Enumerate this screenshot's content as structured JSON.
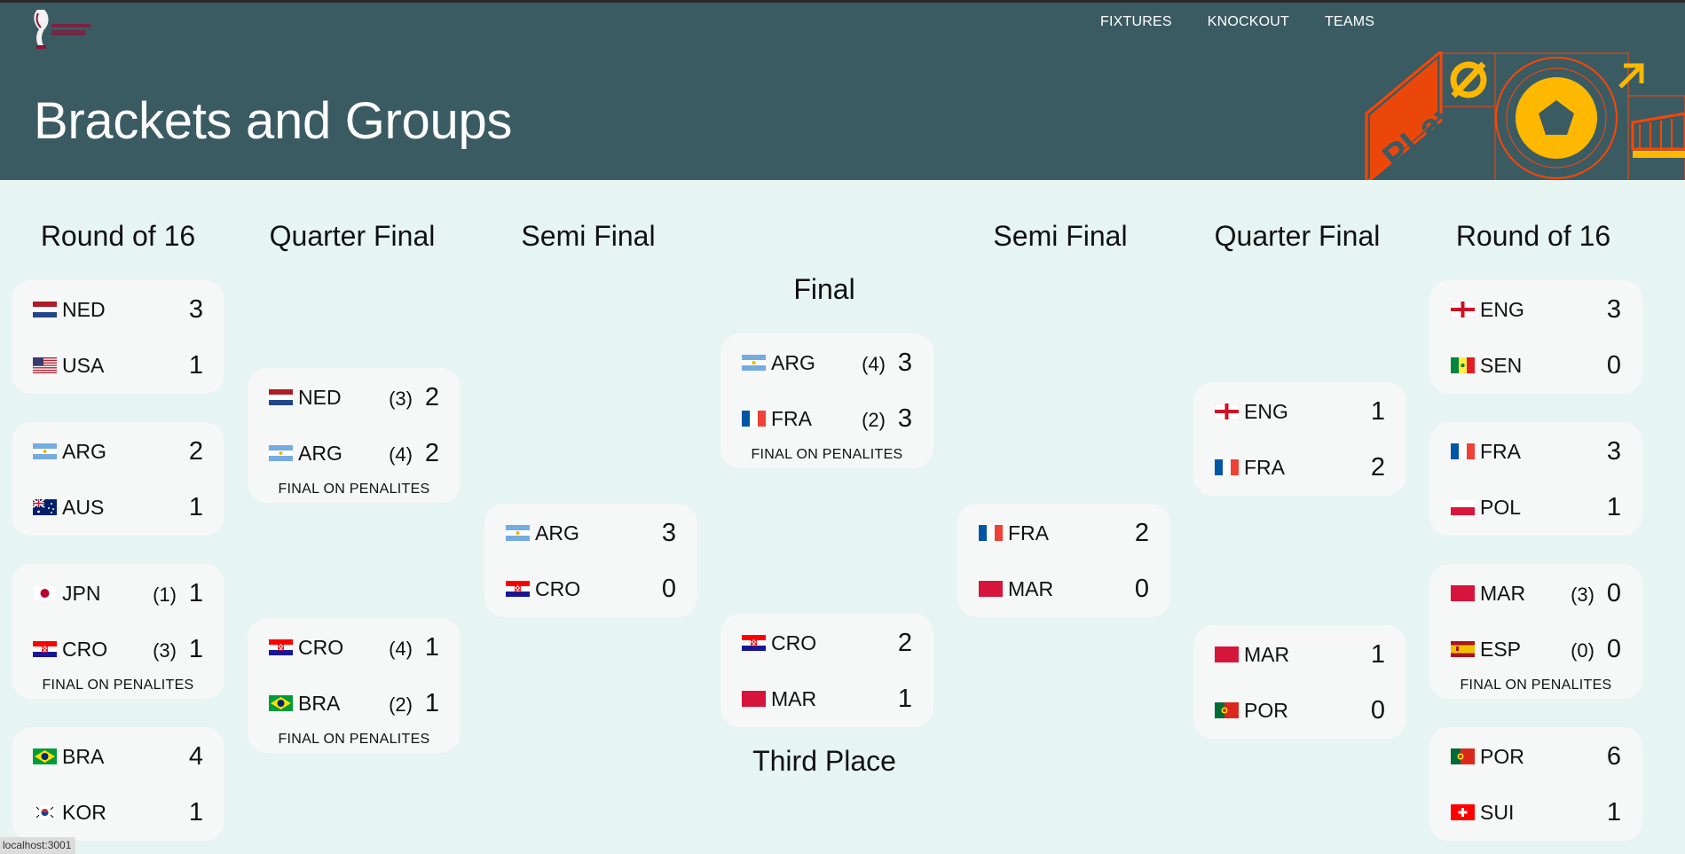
{
  "header": {
    "title": "Brackets and Groups",
    "nav": [
      "FIXTURES",
      "KNOCKOUT",
      "TEAMS"
    ],
    "deco_text": "PLay"
  },
  "columns": [
    "Round of 16",
    "Quarter Final",
    "Semi Final",
    "Final",
    "Semi Final",
    "Quarter Final",
    "Round of 16",
    "Third Place"
  ],
  "penalty_note": "FINAL ON PENALITES",
  "matches": {
    "r16_l1": {
      "teams": [
        {
          "code": "NED",
          "flag": "ned",
          "score": "3",
          "pen": ""
        },
        {
          "code": "USA",
          "flag": "usa",
          "score": "1",
          "pen": ""
        }
      ],
      "note": ""
    },
    "r16_l2": {
      "teams": [
        {
          "code": "ARG",
          "flag": "arg",
          "score": "2",
          "pen": ""
        },
        {
          "code": "AUS",
          "flag": "aus",
          "score": "1",
          "pen": ""
        }
      ],
      "note": ""
    },
    "r16_l3": {
      "teams": [
        {
          "code": "JPN",
          "flag": "jpn",
          "score": "1",
          "pen": "(1)"
        },
        {
          "code": "CRO",
          "flag": "cro",
          "score": "1",
          "pen": "(3)"
        }
      ],
      "note": "FINAL ON PENALITES"
    },
    "r16_l4": {
      "teams": [
        {
          "code": "BRA",
          "flag": "bra",
          "score": "4",
          "pen": ""
        },
        {
          "code": "KOR",
          "flag": "kor",
          "score": "1",
          "pen": ""
        }
      ],
      "note": ""
    },
    "qf_l1": {
      "teams": [
        {
          "code": "NED",
          "flag": "ned",
          "score": "2",
          "pen": "(3)"
        },
        {
          "code": "ARG",
          "flag": "arg",
          "score": "2",
          "pen": "(4)"
        }
      ],
      "note": "FINAL ON PENALITES"
    },
    "qf_l2": {
      "teams": [
        {
          "code": "CRO",
          "flag": "cro",
          "score": "1",
          "pen": "(4)"
        },
        {
          "code": "BRA",
          "flag": "bra",
          "score": "1",
          "pen": "(2)"
        }
      ],
      "note": "FINAL ON PENALITES"
    },
    "sf_l": {
      "teams": [
        {
          "code": "ARG",
          "flag": "arg",
          "score": "3",
          "pen": ""
        },
        {
          "code": "CRO",
          "flag": "cro",
          "score": "0",
          "pen": ""
        }
      ],
      "note": ""
    },
    "final": {
      "teams": [
        {
          "code": "ARG",
          "flag": "arg",
          "score": "3",
          "pen": "(4)"
        },
        {
          "code": "FRA",
          "flag": "fra",
          "score": "3",
          "pen": "(2)"
        }
      ],
      "note": "FINAL ON PENALITES"
    },
    "third": {
      "teams": [
        {
          "code": "CRO",
          "flag": "cro",
          "score": "2",
          "pen": ""
        },
        {
          "code": "MAR",
          "flag": "mar",
          "score": "1",
          "pen": ""
        }
      ],
      "note": ""
    },
    "sf_r": {
      "teams": [
        {
          "code": "FRA",
          "flag": "fra",
          "score": "2",
          "pen": ""
        },
        {
          "code": "MAR",
          "flag": "mar",
          "score": "0",
          "pen": ""
        }
      ],
      "note": ""
    },
    "qf_r1": {
      "teams": [
        {
          "code": "ENG",
          "flag": "eng",
          "score": "1",
          "pen": ""
        },
        {
          "code": "FRA",
          "flag": "fra",
          "score": "2",
          "pen": ""
        }
      ],
      "note": ""
    },
    "qf_r2": {
      "teams": [
        {
          "code": "MAR",
          "flag": "mar",
          "score": "1",
          "pen": ""
        },
        {
          "code": "POR",
          "flag": "por",
          "score": "0",
          "pen": ""
        }
      ],
      "note": ""
    },
    "r16_r1": {
      "teams": [
        {
          "code": "ENG",
          "flag": "eng",
          "score": "3",
          "pen": ""
        },
        {
          "code": "SEN",
          "flag": "sen",
          "score": "0",
          "pen": ""
        }
      ],
      "note": ""
    },
    "r16_r2": {
      "teams": [
        {
          "code": "FRA",
          "flag": "fra",
          "score": "3",
          "pen": ""
        },
        {
          "code": "POL",
          "flag": "pol",
          "score": "1",
          "pen": ""
        }
      ],
      "note": ""
    },
    "r16_r3": {
      "teams": [
        {
          "code": "MAR",
          "flag": "mar",
          "score": "0",
          "pen": "(3)"
        },
        {
          "code": "ESP",
          "flag": "esp",
          "score": "0",
          "pen": "(0)"
        }
      ],
      "note": "FINAL ON PENALITES"
    },
    "r16_r4": {
      "teams": [
        {
          "code": "POR",
          "flag": "por",
          "score": "6",
          "pen": ""
        },
        {
          "code": "SUI",
          "flag": "sui",
          "score": "1",
          "pen": ""
        }
      ],
      "note": ""
    }
  },
  "status_bar": "localhost:3001",
  "colors": {
    "header": "#3b5b63",
    "page": "#e6f5f1",
    "card": "#f6f7f7",
    "accent_orange": "#ff4500",
    "accent_yellow": "#ffb800"
  }
}
